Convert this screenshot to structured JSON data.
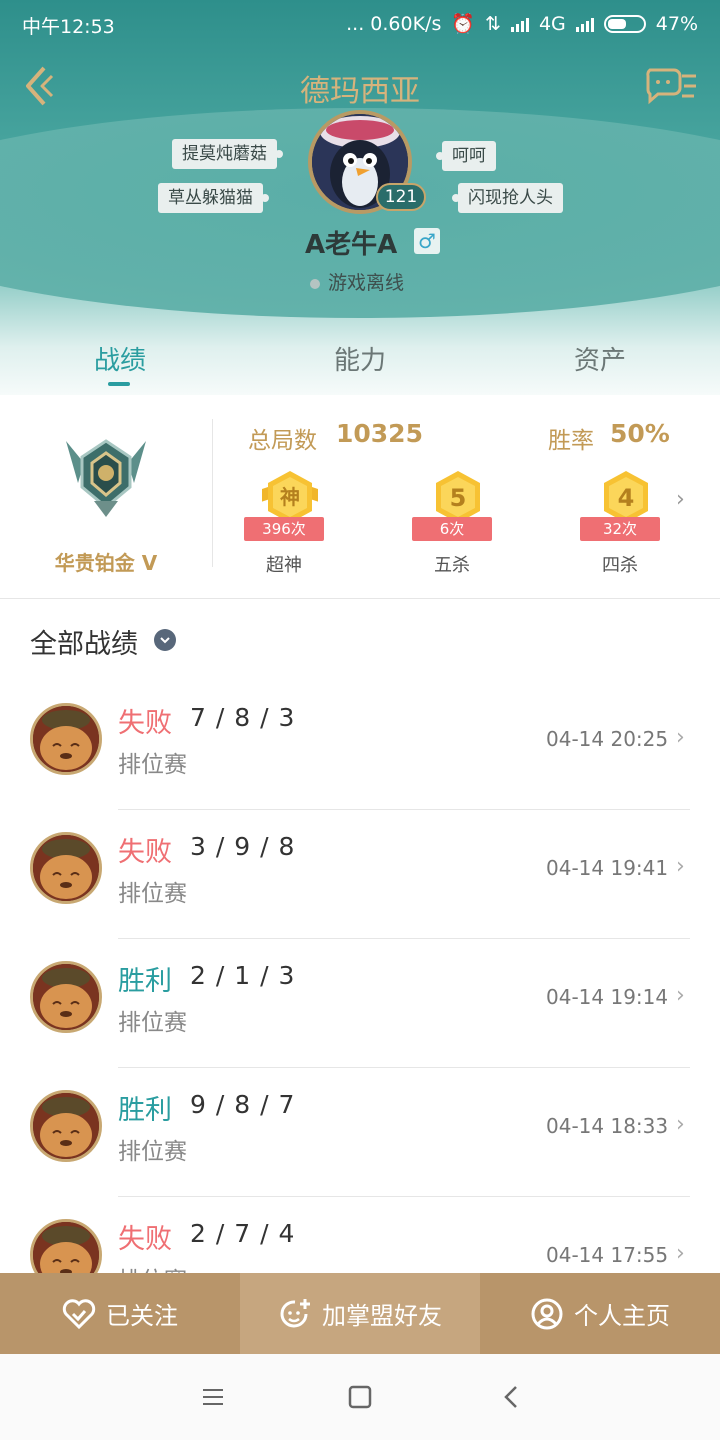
{
  "status_bar": {
    "time": "中午12:53",
    "network_speed": "... 0.60K/s",
    "network_type": "4G",
    "battery": "47%"
  },
  "header": {
    "server": "德玛西亚",
    "player_name": "A老牛A",
    "gender_symbol": "♂",
    "online_status": "游戏离线",
    "level": "121",
    "tags_left": [
      "提莫炖蘑菇",
      "草丛躲猫猫"
    ],
    "tags_right": [
      "呵呵",
      "闪现抢人头"
    ]
  },
  "tabs": [
    {
      "label": "战绩",
      "active": true
    },
    {
      "label": "能力",
      "active": false
    },
    {
      "label": "资产",
      "active": false
    }
  ],
  "stats": {
    "rank_name": "华贵铂金 V",
    "total_games_label": "总局数",
    "total_games": "10325",
    "win_rate_label": "胜率",
    "win_rate": "50%",
    "medals": [
      {
        "glyph": "神",
        "count": "396次",
        "label": "超神"
      },
      {
        "glyph": "5",
        "count": "6次",
        "label": "五杀"
      },
      {
        "glyph": "4",
        "count": "32次",
        "label": "四杀"
      }
    ]
  },
  "matches_section": {
    "title": "全部战绩",
    "items": [
      {
        "result": "失败",
        "outcome": "lose",
        "kda": "7 / 8 / 3",
        "mode": "排位赛",
        "time": "04-14 20:25"
      },
      {
        "result": "失败",
        "outcome": "lose",
        "kda": "3 / 9 / 8",
        "mode": "排位赛",
        "time": "04-14 19:41"
      },
      {
        "result": "胜利",
        "outcome": "win",
        "kda": "2 / 1 / 3",
        "mode": "排位赛",
        "time": "04-14 19:14"
      },
      {
        "result": "胜利",
        "outcome": "win",
        "kda": "9 / 8 / 7",
        "mode": "排位赛",
        "time": "04-14 18:33"
      },
      {
        "result": "失败",
        "outcome": "lose",
        "kda": "2 / 7 / 4",
        "mode": "排位赛",
        "time": "04-14 17:55"
      }
    ]
  },
  "actions": {
    "follow": "已关注",
    "add_friend": "加掌盟好友",
    "profile": "个人主页"
  },
  "colors": {
    "accent": "#2a9da0",
    "gold": "#c29a56",
    "lose": "#ef6f73",
    "win": "#2a9da0"
  }
}
